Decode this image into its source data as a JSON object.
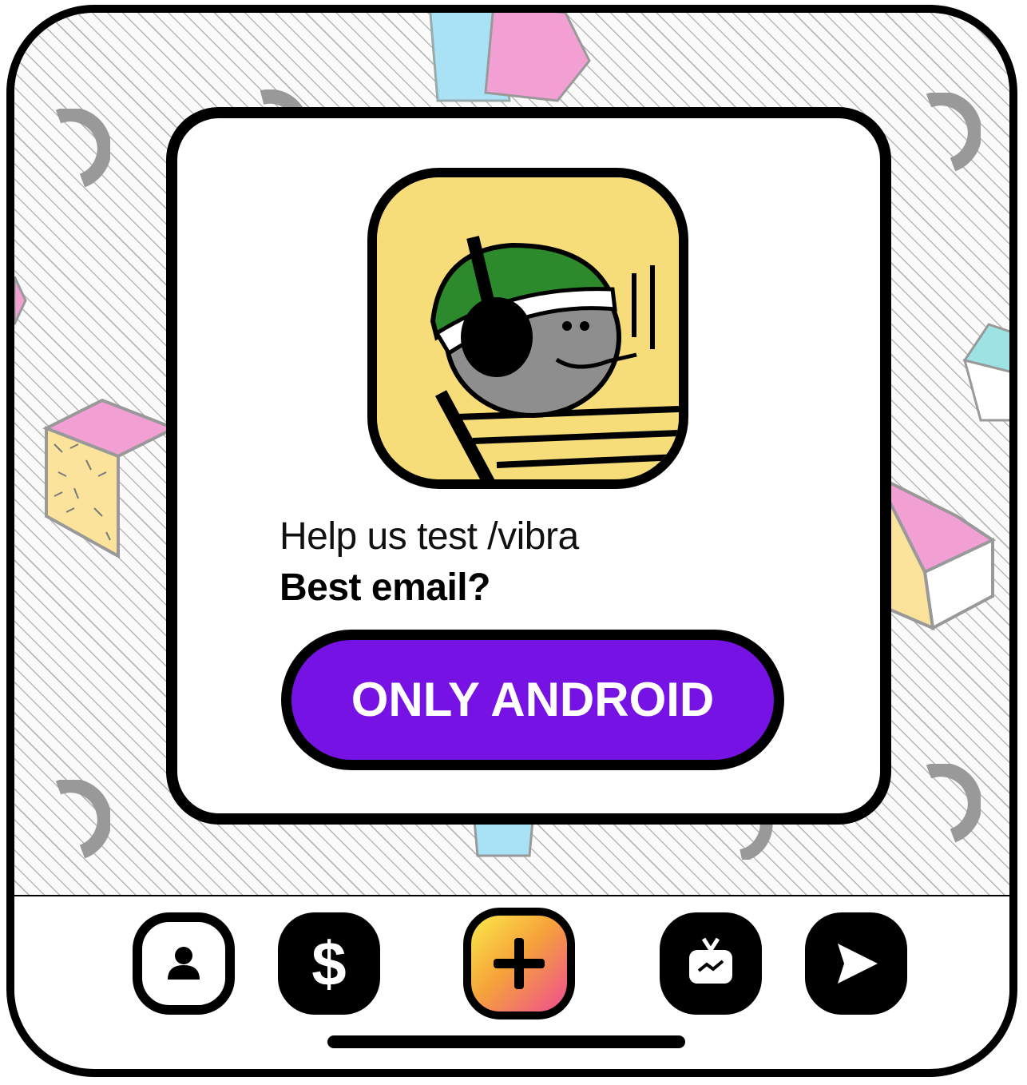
{
  "card": {
    "prompt": "Help us test /vibra",
    "question": "Best email?",
    "cta_label": "ONLY ANDROID"
  },
  "tabbar": {
    "tabs": [
      {
        "name": "profile",
        "icon": "person-icon"
      },
      {
        "name": "money",
        "icon": "dollar-icon",
        "glyph": "$"
      },
      {
        "name": "create",
        "icon": "plus-icon"
      },
      {
        "name": "tv",
        "icon": "tv-icon"
      },
      {
        "name": "send",
        "icon": "send-icon"
      }
    ]
  },
  "colors": {
    "accent": "#7712e5",
    "avatar_bg": "#f6dd7a",
    "create_gradient": [
      "#fbe94a",
      "#f6a43a",
      "#ef4d8f"
    ]
  }
}
